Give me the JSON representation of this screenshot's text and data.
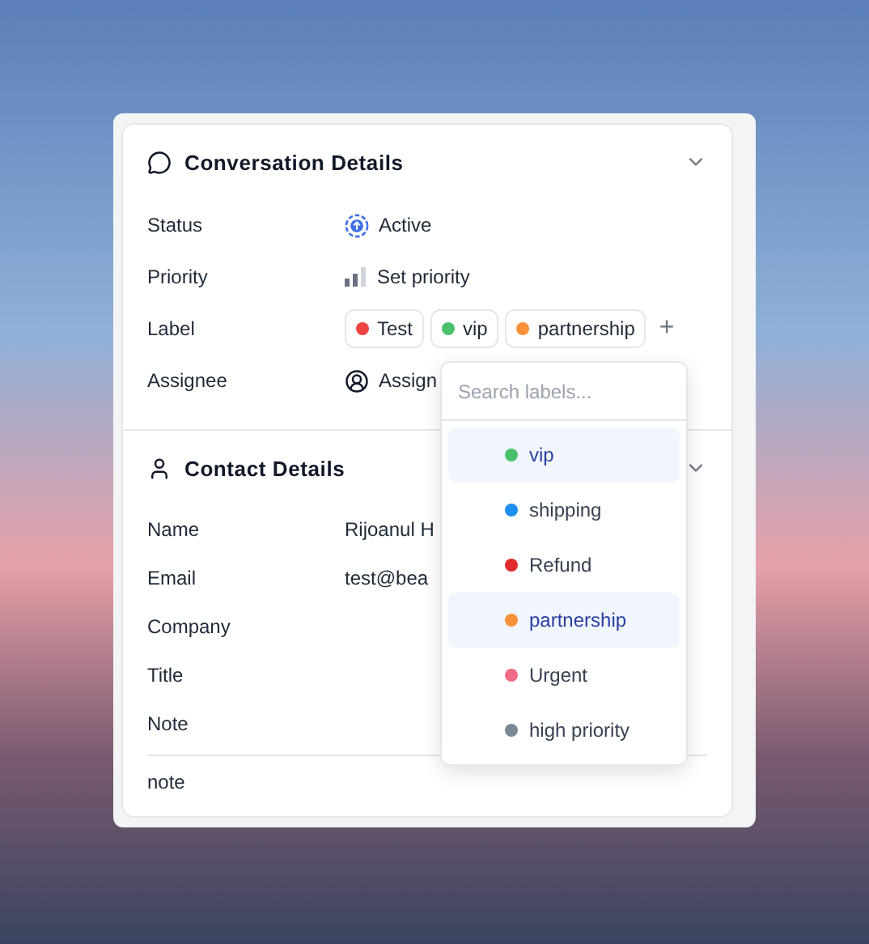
{
  "conversation_details": {
    "title": "Conversation Details",
    "expanded": true,
    "fields": [
      {
        "kind": "status",
        "label": "Status",
        "value": "Active"
      },
      {
        "kind": "priority",
        "label": "Priority",
        "value": "Set priority"
      },
      {
        "kind": "labels",
        "label": "Label",
        "chips": [
          {
            "text": "Test",
            "color": "#ef4444"
          },
          {
            "text": "vip",
            "color": "#4ac06c"
          },
          {
            "text": "partnership",
            "color": "#f7913a"
          }
        ],
        "add_button": "+"
      },
      {
        "kind": "assignee",
        "label": "Assignee",
        "value": "Assign"
      }
    ]
  },
  "contact_details": {
    "title": "Contact Details",
    "expanded": true,
    "fields": [
      {
        "label": "Name",
        "value": "Rijoanul H"
      },
      {
        "label": "Email",
        "value": "test@bea"
      },
      {
        "label": "Company"
      },
      {
        "label": "Title"
      },
      {
        "label": "Note"
      }
    ],
    "note": "note"
  },
  "label_dropdown": {
    "search": {
      "placeholder": "Search labels..."
    },
    "items": [
      {
        "name": "vip",
        "color": "#4ac06c",
        "selected": true
      },
      {
        "name": "shipping",
        "color": "#1e8ff0",
        "selected": false
      },
      {
        "name": "Refund",
        "color": "#e02c2c",
        "selected": false
      },
      {
        "name": "partnership",
        "color": "#f7913a",
        "selected": true
      },
      {
        "name": "Urgent",
        "color": "#f06b85",
        "selected": false
      },
      {
        "name": "high priority",
        "color": "#7a8896",
        "selected": false
      }
    ]
  }
}
